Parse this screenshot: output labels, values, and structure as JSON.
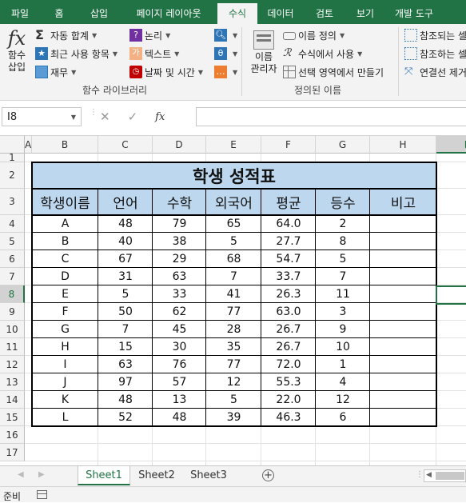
{
  "ribbon_tabs": [
    "파일",
    "홈",
    "삽입",
    "페이지 레이아웃",
    "수식",
    "데이터",
    "검토",
    "보기",
    "개발 도구"
  ],
  "active_tab": "수식",
  "ribbon": {
    "insert_function": "함수\n삽입",
    "insert_function_l1": "함수",
    "insert_function_l2": "삽입",
    "autosum": "자동 합계",
    "recent": "최근 사용 항목",
    "finance": "재무",
    "logical": "논리",
    "text": "텍스트",
    "datetime": "날짜 및 시간",
    "library_label": "함수 라이브러리",
    "name_manager_l1": "이름",
    "name_manager_l2": "관리자",
    "define_name": "이름 정의",
    "use_in_formula": "수식에서 사용",
    "create_from_selection": "선택 영역에서 만들기",
    "defined_names_label": "정의된 이름",
    "trace_precedents": "참조되는 셀",
    "trace_dependents": "참조하는 셀",
    "remove_arrows": "연결선 제거"
  },
  "formula_bar": {
    "name_box": "I8",
    "fx": "fx",
    "content": ""
  },
  "columns": [
    "A",
    "B",
    "C",
    "D",
    "E",
    "F",
    "G",
    "H",
    "I"
  ],
  "rows": [
    "1",
    "2",
    "3",
    "4",
    "5",
    "6",
    "7",
    "8",
    "9",
    "10",
    "11",
    "12",
    "13",
    "14",
    "15",
    "16",
    "17"
  ],
  "selected_cell": {
    "col": "I",
    "row": "8"
  },
  "table": {
    "title": "학생 성적표",
    "headers": [
      "학생이름",
      "언어",
      "수학",
      "외국어",
      "평균",
      "등수",
      "비고"
    ],
    "rows": [
      [
        "A",
        "48",
        "79",
        "65",
        "64.0",
        "2",
        ""
      ],
      [
        "B",
        "40",
        "38",
        "5",
        "27.7",
        "8",
        ""
      ],
      [
        "C",
        "67",
        "29",
        "68",
        "54.7",
        "5",
        ""
      ],
      [
        "D",
        "31",
        "63",
        "7",
        "33.7",
        "7",
        ""
      ],
      [
        "E",
        "5",
        "33",
        "41",
        "26.3",
        "11",
        ""
      ],
      [
        "F",
        "50",
        "62",
        "77",
        "63.0",
        "3",
        ""
      ],
      [
        "G",
        "7",
        "45",
        "28",
        "26.7",
        "9",
        ""
      ],
      [
        "H",
        "15",
        "30",
        "35",
        "26.7",
        "10",
        ""
      ],
      [
        "I",
        "63",
        "76",
        "77",
        "72.0",
        "1",
        ""
      ],
      [
        "J",
        "97",
        "57",
        "12",
        "55.3",
        "4",
        ""
      ],
      [
        "K",
        "48",
        "13",
        "5",
        "22.0",
        "12",
        ""
      ],
      [
        "L",
        "52",
        "48",
        "39",
        "46.3",
        "6",
        ""
      ]
    ]
  },
  "sheets": [
    "Sheet1",
    "Sheet2",
    "Sheet3"
  ],
  "active_sheet": "Sheet1",
  "status": "준비",
  "colors": {
    "brand": "#217346",
    "header_fill": "#bdd7ee"
  }
}
